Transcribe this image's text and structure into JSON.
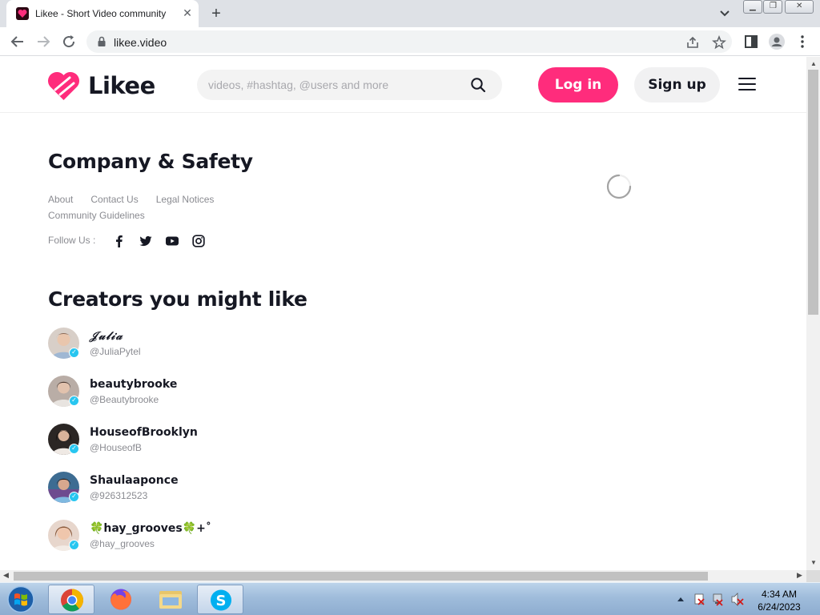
{
  "browser": {
    "tab_title": "Likee - Short Video community",
    "url": "likee.video"
  },
  "header": {
    "logo_text": "Likee",
    "search_placeholder": "videos, #hashtag, @users and more",
    "login_label": "Log in",
    "signup_label": "Sign up"
  },
  "company": {
    "title": "Company & Safety",
    "links": [
      "About",
      "Contact Us",
      "Legal Notices",
      "Community Guidelines"
    ],
    "follow_label": "Follow Us :",
    "social_icons": [
      "facebook-icon",
      "twitter-icon",
      "youtube-icon",
      "instagram-icon"
    ]
  },
  "creators": {
    "title": "Creators you might like",
    "items": [
      {
        "name": "𝒥𝓊𝓁𝒾𝒶",
        "handle": "@JuliaPytel",
        "avatar_color": "#c9b6a6"
      },
      {
        "name": "beautybrooke",
        "handle": "@Beautybrooke",
        "avatar_color": "#a79a93"
      },
      {
        "name": "HouseofBrooklyn",
        "handle": "@HouseofB",
        "avatar_color": "#3a3230"
      },
      {
        "name": "Shaulaaponce",
        "handle": "@926312523",
        "avatar_color": "#4f7fa6"
      },
      {
        "name": "🍀hay_grooves🍀+˚",
        "handle": "@hay_grooves",
        "avatar_color": "#d2a894"
      }
    ]
  },
  "taskbar": {
    "time": "4:34 AM",
    "date": "6/24/2023"
  },
  "colors": {
    "brand": "#ff2c7c",
    "text": "#161823",
    "muted": "#8a8b91",
    "verified": "#28c6f0"
  }
}
